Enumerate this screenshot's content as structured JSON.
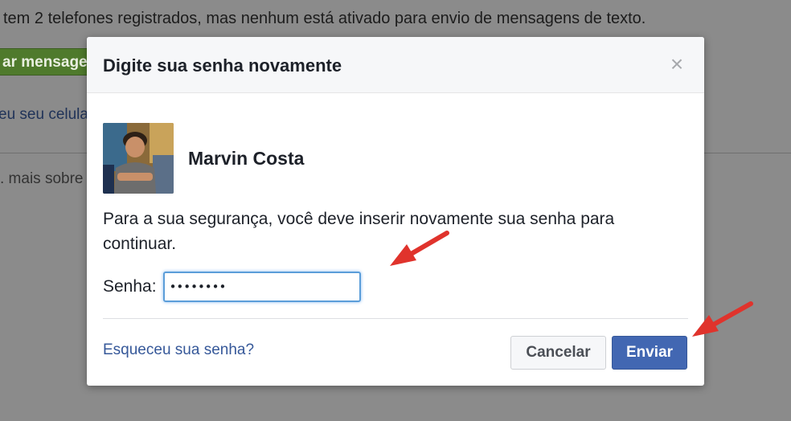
{
  "background": {
    "top_text": "tem 2 telefones registrados, mas nenhum está ativado para envio de mensagens de texto.",
    "green_button_label": "ar mensage",
    "link_text": "eu seu celula",
    "more_text": ". mais sobre"
  },
  "dialog": {
    "title": "Digite sua senha novamente",
    "close_symbol": "×",
    "user_name": "Marvin Costa",
    "message": "Para a sua segurança, você deve inserir novamente sua senha para continuar.",
    "password_label": "Senha:",
    "password_value": "••••••••",
    "forgot_link": "Esqueceu sua senha?",
    "cancel_label": "Cancelar",
    "submit_label": "Enviar"
  },
  "colors": {
    "primary_button": "#4267b2",
    "link": "#365899",
    "annotation_arrow": "#e0332c",
    "input_focus": "#5b9dd9"
  }
}
